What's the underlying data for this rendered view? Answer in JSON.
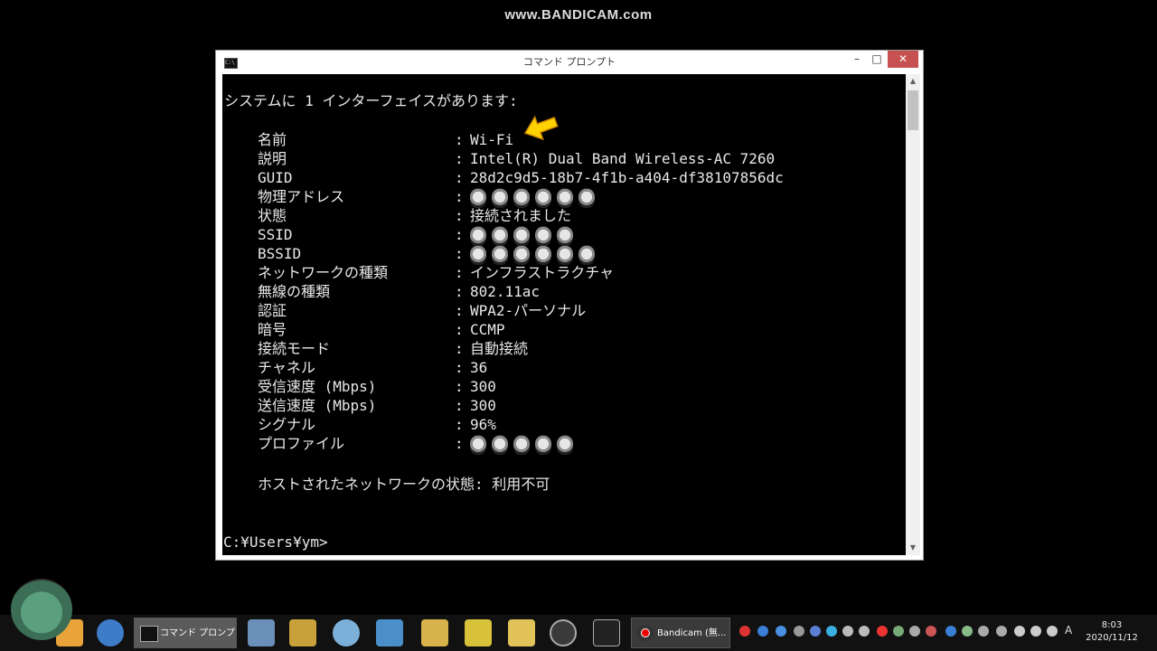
{
  "watermark": "www.BANDICAM.com",
  "window": {
    "title": "コマンド プロンプト",
    "icon": "cmd-icon",
    "minimize": "–",
    "maximize": "□",
    "close": "✕"
  },
  "console": {
    "header": "システムに 1 インターフェイスがあります:",
    "separator": ":",
    "rows": [
      {
        "label": "名前",
        "value": "Wi-Fi"
      },
      {
        "label": "説明",
        "value": "Intel(R) Dual Band Wireless-AC 7260"
      },
      {
        "label": "GUID",
        "value": "28d2c9d5-18b7-4f1b-a404-df38107856dc"
      },
      {
        "label": "物理アドレス",
        "value": ""
      },
      {
        "label": "状態",
        "value": "接続されました"
      },
      {
        "label": "SSID",
        "value": ""
      },
      {
        "label": "BSSID",
        "value": ""
      },
      {
        "label": "ネットワークの種類",
        "value": "インフラストラクチャ"
      },
      {
        "label": "無線の種類",
        "value": "802.11ac"
      },
      {
        "label": "認証",
        "value": "WPA2-パーソナル"
      },
      {
        "label": "暗号",
        "value": "CCMP"
      },
      {
        "label": "接続モード",
        "value": "自動接続"
      },
      {
        "label": "チャネル",
        "value": "36"
      },
      {
        "label": "受信速度 (Mbps)",
        "value": "300"
      },
      {
        "label": "送信速度 (Mbps)",
        "value": "300"
      },
      {
        "label": "シグナル",
        "value": "96%"
      },
      {
        "label": "プロファイル",
        "value": ""
      }
    ],
    "hosted_network": "ホストされたネットワークの状態: 利用不可",
    "prompt": "C:¥Users¥ym>"
  },
  "taskbar": {
    "cmd_button": "コマンド プロンプト",
    "bandicam_button": "Bandicam (無...",
    "input_indicator": "A",
    "time": "8:03",
    "date": "2020/11/12"
  },
  "colors": {
    "arrow": "#ffd200",
    "close_button": "#c75050",
    "console_text": "#e8e8e8",
    "console_bg": "#000000"
  }
}
